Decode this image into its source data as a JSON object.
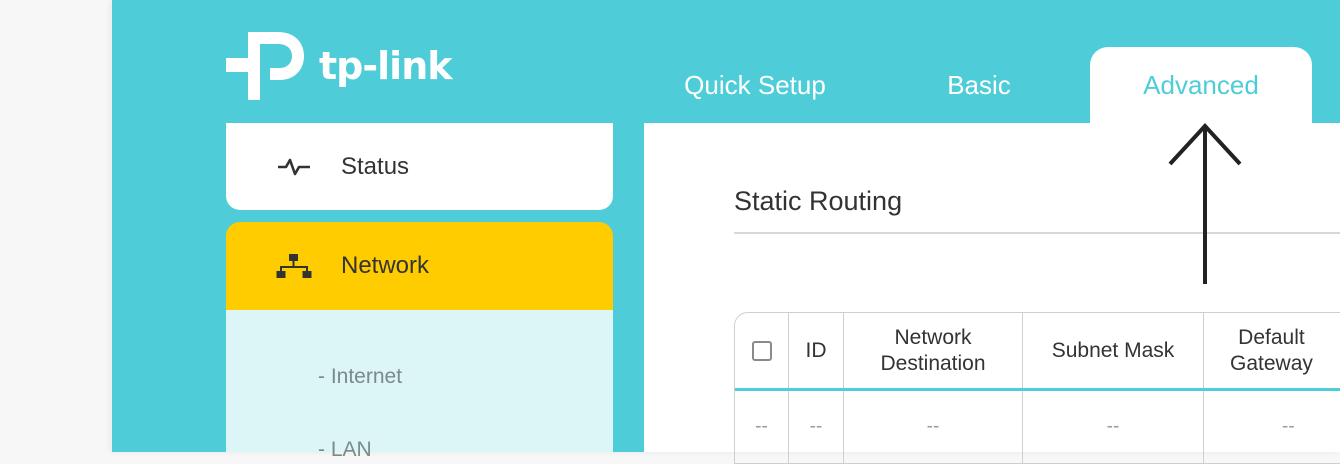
{
  "brand": {
    "name": "tp-link",
    "logo_icon": "tp-link-logo-icon"
  },
  "tabs": [
    {
      "label": "Quick Setup",
      "active": false
    },
    {
      "label": "Basic",
      "active": false
    },
    {
      "label": "Advanced",
      "active": true
    }
  ],
  "sidebar": {
    "status": {
      "label": "Status",
      "icon": "pulse-icon"
    },
    "network": {
      "label": "Network",
      "icon": "network-icon"
    },
    "submenu": [
      "- Internet",
      "- LAN"
    ]
  },
  "main": {
    "section_title": "Static Routing",
    "table": {
      "headers": [
        "",
        "ID",
        "Network\nDestination",
        "Subnet Mask",
        "Default\nGateway"
      ],
      "rows": [
        [
          "--",
          "--",
          "--",
          "--",
          "--"
        ]
      ]
    }
  },
  "colors": {
    "accent": "#4ecdd8",
    "active_menu": "#ffcc00",
    "submenu_bg": "#dcf5f6",
    "annotation_arrow": "#222222"
  }
}
